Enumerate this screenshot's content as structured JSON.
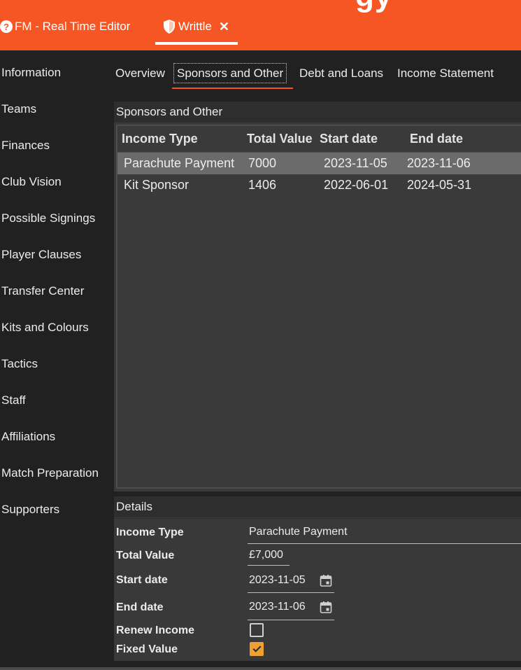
{
  "window": {
    "title_fragment": "gy",
    "tabs": [
      {
        "label": "FM - Real Time Editor",
        "icon": "help-icon"
      },
      {
        "label": "Writtle",
        "icon": "shield-icon",
        "closable": true
      }
    ],
    "close_glyph": "✕",
    "help_glyph": "?"
  },
  "sidebar": {
    "items": [
      {
        "label": "Information"
      },
      {
        "label": "Teams"
      },
      {
        "label": "Finances"
      },
      {
        "label": "Club Vision"
      },
      {
        "label": "Possible Signings"
      },
      {
        "label": "Player Clauses"
      },
      {
        "label": "Transfer Center"
      },
      {
        "label": "Kits and Colours"
      },
      {
        "label": "Tactics"
      },
      {
        "label": "Staff"
      },
      {
        "label": "Affiliations"
      },
      {
        "label": "Match Preparation"
      },
      {
        "label": "Supporters"
      }
    ]
  },
  "content_tabs": [
    {
      "label": "Overview",
      "active": false
    },
    {
      "label": "Sponsors and Other",
      "active": true
    },
    {
      "label": "Debt and Loans",
      "active": false
    },
    {
      "label": "Income Statement",
      "active": false
    }
  ],
  "sponsors_panel": {
    "title": "Sponsors and Other",
    "columns": [
      "Income Type",
      "Total Value",
      "Start date",
      "End date"
    ],
    "rows": [
      {
        "income_type": "Parachute Payment",
        "total_value": "7000",
        "start_date": "2023-11-05",
        "end_date": "2023-11-06",
        "selected": true
      },
      {
        "income_type": "Kit Sponsor",
        "total_value": "1406",
        "start_date": "2022-06-01",
        "end_date": "2024-05-31",
        "selected": false
      }
    ]
  },
  "details_panel": {
    "title": "Details",
    "fields": {
      "income_type": {
        "label": "Income Type",
        "value": "Parachute Payment"
      },
      "total_value": {
        "label": "Total Value",
        "value": "£7,000"
      },
      "start_date": {
        "label": "Start date",
        "value": "2023-11-05"
      },
      "end_date": {
        "label": "End date",
        "value": "2023-11-06"
      },
      "renew_income": {
        "label": "Renew Income",
        "checked": false
      },
      "fixed_value": {
        "label": "Fixed Value",
        "checked": true
      }
    }
  },
  "colors": {
    "accent": "#f65524",
    "checkbox_checked": "#f0a030",
    "background": "#212121",
    "panel": "#393939",
    "selected_row": "#6b6b6b"
  }
}
